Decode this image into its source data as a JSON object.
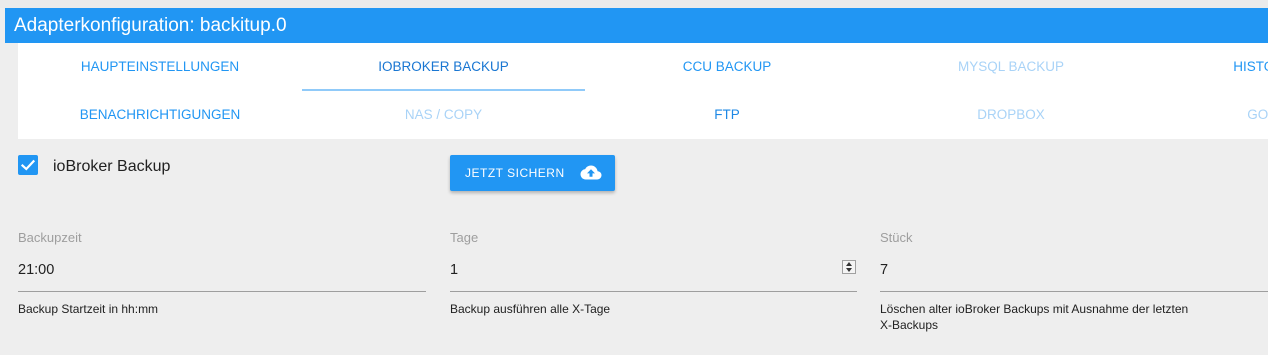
{
  "window": {
    "title": "Adapterkonfiguration: backitup.0"
  },
  "tabs": {
    "row1": [
      {
        "label": "HAUPTEINSTELLUNGEN",
        "state": "normal"
      },
      {
        "label": "IOBROKER BACKUP",
        "state": "active"
      },
      {
        "label": "CCU BACKUP",
        "state": "normal"
      },
      {
        "label": "MYSQL BACKUP",
        "state": "disabled"
      },
      {
        "label": "HISTORY",
        "state": "normal"
      }
    ],
    "row2": [
      {
        "label": "BENACHRICHTIGUNGEN",
        "state": "normal"
      },
      {
        "label": "NAS / COPY",
        "state": "disabled"
      },
      {
        "label": "FTP",
        "state": "normal"
      },
      {
        "label": "DROPBOX",
        "state": "disabled"
      },
      {
        "label": "GOO",
        "state": "disabled"
      }
    ]
  },
  "iobroker_backup": {
    "enabled_label": "ioBroker Backup",
    "enabled": true,
    "backup_now_label": "JETZT SICHERN"
  },
  "fields": {
    "backupzeit": {
      "label": "Backupzeit",
      "value": "21:00",
      "help": "Backup Startzeit in hh:mm"
    },
    "tage": {
      "label": "Tage",
      "value": "1",
      "help": "Backup ausführen alle X-Tage"
    },
    "stueck": {
      "label": "Stück",
      "value": "7",
      "help_line1": "Löschen alter ioBroker Backups mit Ausnahme der letzten",
      "help_line2": "X-Backups"
    }
  },
  "icons": {
    "checkbox": "check-icon",
    "backup_button": "cloud-upload-icon",
    "number_spinner": "spinner-arrows-icon"
  },
  "colors": {
    "accent": "#2196f3",
    "background": "#eeeeee",
    "panel": "#ffffff"
  }
}
